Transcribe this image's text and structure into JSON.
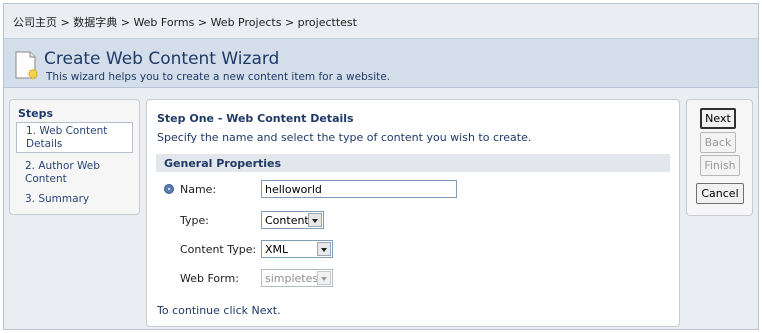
{
  "breadcrumb": {
    "items": [
      "公司主页",
      "数据字典",
      "Web Forms",
      "Web Projects",
      "projecttest"
    ],
    "separator": ">"
  },
  "header": {
    "title": "Create Web Content Wizard",
    "subtitle": "This wizard helps you to create a new content item for a website."
  },
  "steps": {
    "heading": "Steps",
    "items": [
      {
        "label": "1. Web Content Details",
        "active": true
      },
      {
        "label": "2. Author Web Content",
        "active": false
      },
      {
        "label": "3. Summary",
        "active": false
      }
    ]
  },
  "main": {
    "title": "Step One - Web Content Details",
    "description": "Specify the name and select the type of content you wish to create.",
    "section_title": "General Properties",
    "fields": {
      "name": {
        "label": "Name:",
        "value": "helloworld",
        "required": true
      },
      "type": {
        "label": "Type:",
        "value": "Content"
      },
      "content_type": {
        "label": "Content Type:",
        "value": "XML"
      },
      "web_form": {
        "label": "Web Form:",
        "value": "simpletest",
        "disabled": true
      }
    },
    "continue_text": "To continue click Next."
  },
  "buttons": {
    "next": "Next",
    "back": "Back",
    "finish": "Finish",
    "cancel": "Cancel"
  },
  "colors": {
    "header_bg": "#d4deea",
    "title_text": "#1f3a67",
    "page_bg": "#eaedf1"
  }
}
